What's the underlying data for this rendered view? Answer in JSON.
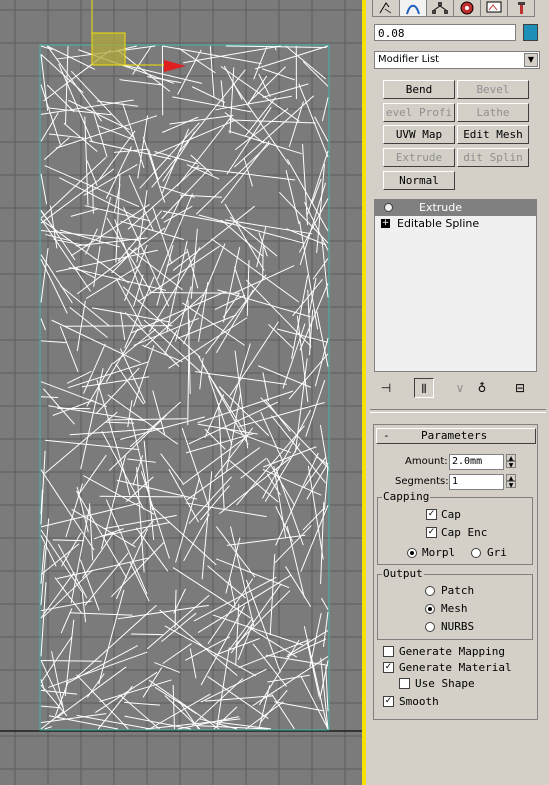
{
  "command_panel": {
    "tabs": [
      "create-icon",
      "modify-icon",
      "hierarchy-icon",
      "motion-icon",
      "display-icon",
      "utilities-icon"
    ],
    "object_name": "0.08",
    "object_color": "#1e90b8",
    "modifier_list": "Modifier List",
    "modifier_buttons": [
      {
        "label": "Bend",
        "enabled": true
      },
      {
        "label": "Bevel",
        "enabled": false
      },
      {
        "label": "evel Profi",
        "enabled": false
      },
      {
        "label": "Lathe",
        "enabled": false
      },
      {
        "label": "UVW Map",
        "enabled": true
      },
      {
        "label": "Edit Mesh",
        "enabled": true
      },
      {
        "label": "Extrude",
        "enabled": false
      },
      {
        "label": "dit Splin",
        "enabled": false
      },
      {
        "label": "Normal",
        "enabled": true
      }
    ],
    "stack": [
      {
        "label": "Extrude",
        "selected": true
      },
      {
        "label": "Editable Spline",
        "selected": false
      }
    ]
  },
  "parameters": {
    "title": "Parameters",
    "amount_label": "Amount:",
    "amount_value": "2.0mm",
    "segments_label": "Segments:",
    "segments_value": "1",
    "capping": {
      "title": "Capping",
      "cap_start": "Cap",
      "cap_end": "Cap Enc",
      "morph": "Morpl",
      "grid": "Gri"
    },
    "output": {
      "title": "Output",
      "patch": "Patch",
      "mesh": "Mesh",
      "nurbs": "NURBS"
    },
    "generate_mapping": "Generate Mapping",
    "generate_material": "Generate Material",
    "use_shape": "Use Shape",
    "smooth": "Smooth"
  }
}
